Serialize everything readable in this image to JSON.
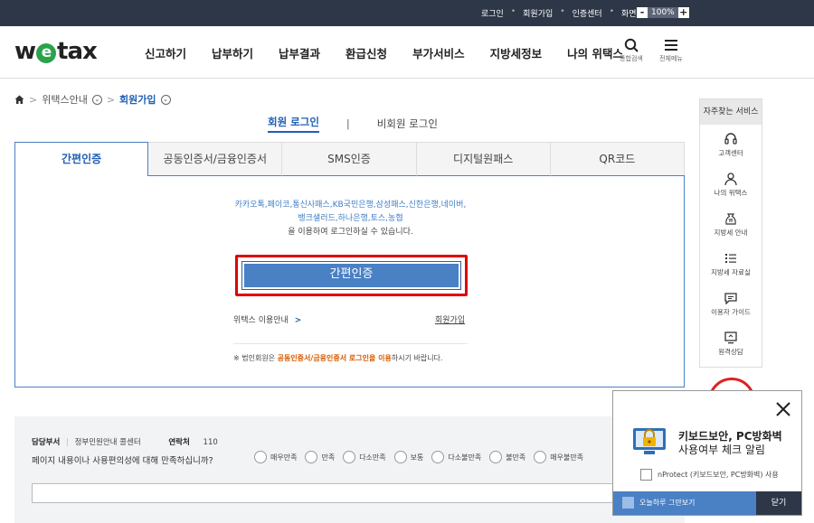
{
  "topbar": {
    "links": [
      "로그인",
      "회원가입",
      "인증센터",
      "화면크기"
    ],
    "zoom_minus": "-",
    "zoom_value": "100%",
    "zoom_plus": "+"
  },
  "header": {
    "logo_prefix": "w",
    "logo_e": "e",
    "logo_suffix": "tax",
    "nav": [
      "신고하기",
      "납부하기",
      "납부결과",
      "환급신청",
      "부가서비스",
      "지방세정보",
      "나의 위택스"
    ],
    "search_label": "통합검색",
    "menu_label": "전체메뉴"
  },
  "breadcrumb": {
    "level1": "위택스안내",
    "level2": "회원가입"
  },
  "login_type": {
    "member": "회원 로그인",
    "divider": "|",
    "guest": "비회원 로그인"
  },
  "auth_tabs": [
    "간편인증",
    "공동인증서/금융인증서",
    "SMS인증",
    "디지털원패스",
    "QR코드"
  ],
  "panel": {
    "providers_line1": "카카오톡,페이코,통신사패스,KB국민은행,삼성패스,신한은행,네이버,",
    "providers_line2": "뱅크샐러드,하나은행,토스,농협",
    "providers_desc": "을 이용하여 로그인하실 수 있습니다.",
    "simple_button": "간편인증",
    "guide_link": "위택스 이용안내",
    "guide_arrow": ">",
    "join_link": "회원가입",
    "notice_prefix": "※ 법인회원은 ",
    "notice_highlight": "공동인증서/금융인증서 로그인을 이용",
    "notice_suffix": "하시기 바랍니다."
  },
  "survey": {
    "dept_label": "담당부서",
    "dept_value": "정부민원안내 콜센터",
    "contact_label": "연락처",
    "contact_value": "110",
    "question": "페이지 내용이나 사용편의성에 대해 만족하십니까?",
    "options": [
      "매우만족",
      "만족",
      "다소만족",
      "보통",
      "다소불만족",
      "불만족",
      "매우불만족"
    ]
  },
  "quick_menu": {
    "title": "자주찾는 서비스",
    "items": [
      "고객센터",
      "나의 위택스",
      "지방세 안내",
      "지방세 자료실",
      "이용자 가이드",
      "원격상담"
    ]
  },
  "popup": {
    "title_line1": "키보드보안, PC방화벽",
    "title_line2": "사용여부 체크 알림",
    "checkbox_label": "nProtect (키보드보안, PC방화벽) 사용",
    "no_show_today": "오늘하루 그만보기",
    "close_button": "닫기"
  },
  "colors": {
    "topbar": "#2d3748",
    "accent_blue": "#1f5fb3",
    "button_blue": "#4a80c4",
    "highlight_red": "#e00000",
    "logo_green": "#2aa34a"
  }
}
